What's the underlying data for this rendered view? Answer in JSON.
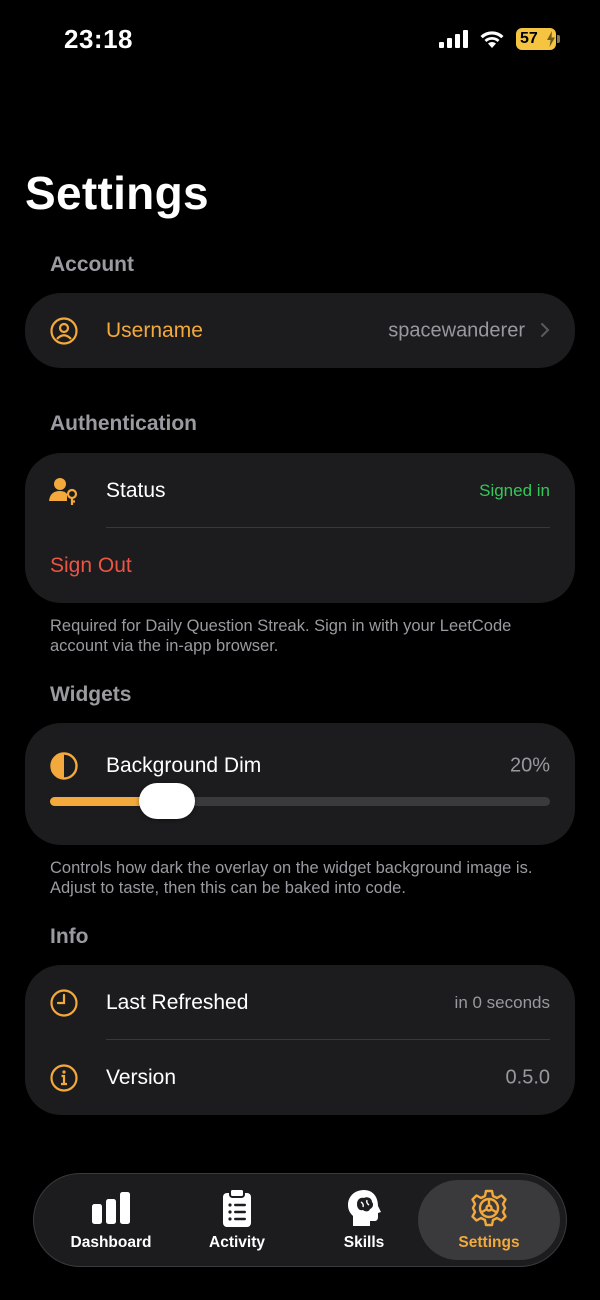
{
  "status_bar": {
    "time": "23:18",
    "battery": "57"
  },
  "page_title": "Settings",
  "colors": {
    "accent": "#f3a93b",
    "destructive": "#eb5545",
    "success": "#34c759",
    "card": "#1c1c1e"
  },
  "account": {
    "header": "Account",
    "username_label": "Username",
    "username_value": "spacewanderer",
    "icon": "person-circle-icon"
  },
  "authentication": {
    "header": "Authentication",
    "status_label": "Status",
    "status_value": "Signed in",
    "sign_out_label": "Sign Out",
    "footnote": "Required for Daily Question Streak. Sign in with your LeetCode account via the in-app browser.",
    "icon": "person-key-icon"
  },
  "widgets": {
    "header": "Widgets",
    "dim_label": "Background Dim",
    "dim_value": "20%",
    "dim_level": 0.2,
    "footnote": "Controls how dark the overlay on the widget background image is. Adjust to taste, then this can be baked into code.",
    "icon": "half-circle-icon"
  },
  "info": {
    "header": "Info",
    "refreshed_label": "Last Refreshed",
    "refreshed_value": "in 0 seconds",
    "version_label": "Version",
    "version_value": "0.5.0"
  },
  "tabs": [
    {
      "label": "Dashboard",
      "icon": "bar-chart-icon",
      "active": false
    },
    {
      "label": "Activity",
      "icon": "clipboard-list-icon",
      "active": false
    },
    {
      "label": "Skills",
      "icon": "head-brain-icon",
      "active": false
    },
    {
      "label": "Settings",
      "icon": "gear-icon",
      "active": true
    }
  ]
}
